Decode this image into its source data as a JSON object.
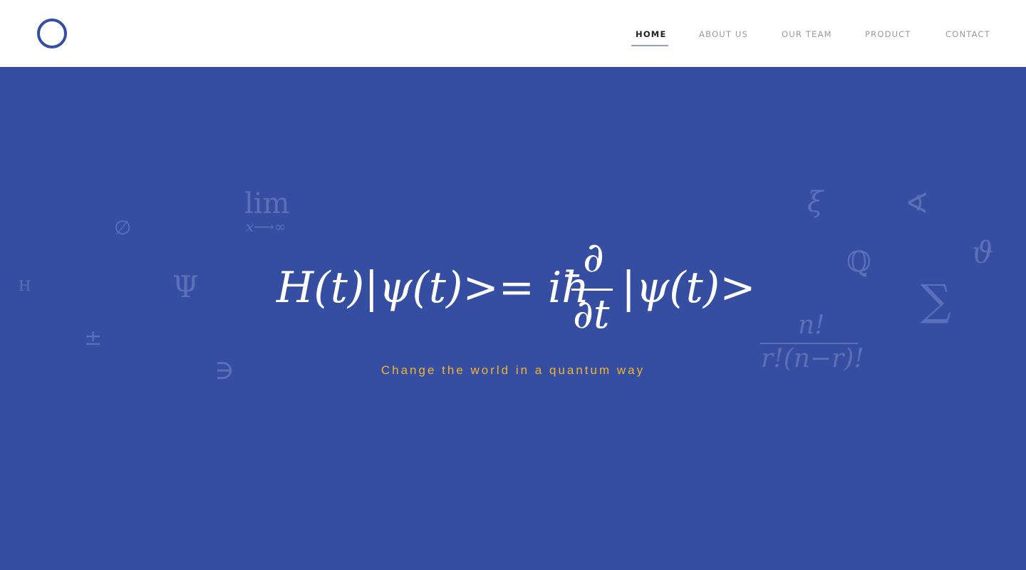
{
  "nav": {
    "items": [
      {
        "label": "HOME",
        "active": true
      },
      {
        "label": "ABOUT US",
        "active": false
      },
      {
        "label": "OUR TEAM",
        "active": false
      },
      {
        "label": "PRODUCT",
        "active": false
      },
      {
        "label": "CONTACT",
        "active": false
      }
    ]
  },
  "hero": {
    "formula": {
      "lhs": "H(t)|ψ(t)>= iħ",
      "frac_num": "∂",
      "frac_den": "∂t",
      "rhs": "|ψ(t)>"
    },
    "tagline": "Change the world in a quantum way",
    "symbols": {
      "lim": "lim",
      "lim_sub": "x⟶∞",
      "empty_set": "∅",
      "psi_upper": "Ψ",
      "h_letter": "H",
      "plus_minus": "±",
      "contains": "∋",
      "xi": "ξ",
      "angle": "∢",
      "rationals": "ℚ",
      "vartheta": "ϑ",
      "sigma": "∑",
      "comb_num": "n!",
      "comb_den": "r!(n−r)!"
    }
  },
  "colors": {
    "accent": "#344ea3",
    "hero_bg": "#354ea2",
    "tagline": "#f2b52c",
    "faint_symbol": "#5b70b6"
  }
}
